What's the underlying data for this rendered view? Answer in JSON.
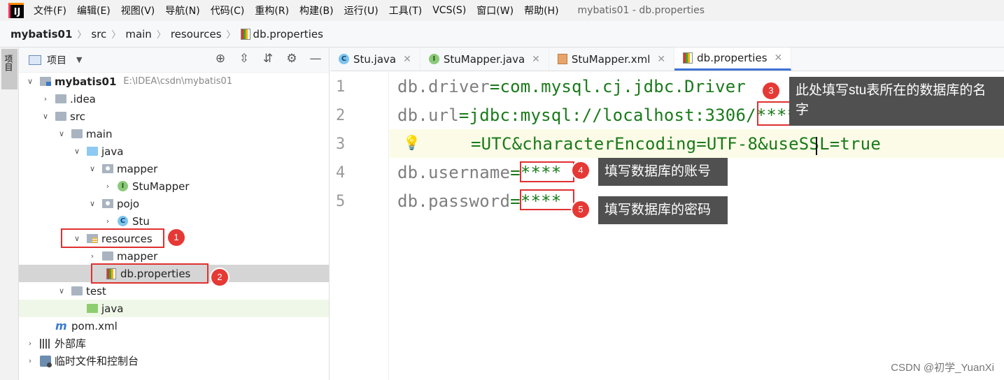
{
  "menubar": {
    "logo": "IJ",
    "items": [
      "文件(F)",
      "编辑(E)",
      "视图(V)",
      "导航(N)",
      "代码(C)",
      "重构(R)",
      "构建(B)",
      "运行(U)",
      "工具(T)",
      "VCS(S)",
      "窗口(W)",
      "帮助(H)"
    ],
    "window_title": "mybatis01 - db.properties"
  },
  "breadcrumb": [
    "mybatis01",
    "src",
    "main",
    "resources",
    "db.properties"
  ],
  "sidebar": {
    "project_tool": "项目"
  },
  "project_panel": {
    "title": "项目",
    "tree": {
      "root": "mybatis01",
      "root_path": "E:\\IDEA\\csdn\\mybatis01",
      "idea": ".idea",
      "src": "src",
      "main": "main",
      "java": "java",
      "mapper": "mapper",
      "stumapper": "StuMapper",
      "pojo": "pojo",
      "stu": "Stu",
      "resources": "resources",
      "res_mapper": "mapper",
      "db_properties": "db.properties",
      "test": "test",
      "test_java": "java",
      "pom": "pom.xml",
      "external_libs": "外部库",
      "scratches": "临时文件和控制台"
    }
  },
  "tabs": [
    "Stu.java",
    "StuMapper.java",
    "StuMapper.xml",
    "db.properties"
  ],
  "editor": {
    "line_numbers": [
      "1",
      "2",
      "3",
      "4",
      "5"
    ],
    "l1_key": "db.driver",
    "l1_eq": "=",
    "l1_val": "com.mysql.cj.jdbc.Driver",
    "l2_key": "db.url",
    "l2_eq": "=",
    "l2_val": "jdbc:mysql://localhost:3306/****?serverTimezone\\",
    "l3_val": "=UTC&characterEncoding=UTF-8&useSSL=true",
    "l4_key": "db.username",
    "l4_eq": "=",
    "l4_val": "****",
    "l5_key": "db.password",
    "l5_eq": "=",
    "l5_val": "****"
  },
  "annotations": {
    "badges": [
      "1",
      "2",
      "3",
      "4",
      "5"
    ],
    "tip3": "此处填写stu表所在的数据库的名字",
    "tip4": "填写数据库的账号",
    "tip5": "填写数据库的密码"
  },
  "watermark": "CSDN @初学_YuanXi"
}
